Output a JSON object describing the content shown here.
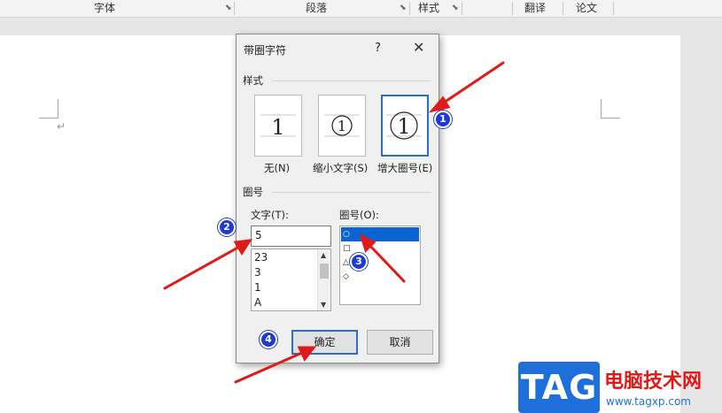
{
  "ribbon": {
    "groups": [
      {
        "label": "字体"
      },
      {
        "label": "段落"
      },
      {
        "label": "样式"
      },
      {
        "label": "翻译"
      },
      {
        "label": "论文"
      }
    ]
  },
  "document": {
    "paragraph_mark": "↵"
  },
  "dialog": {
    "title": "带圈字符",
    "help": "?",
    "close": "✕",
    "style_section": "样式",
    "style_options": [
      {
        "glyph": "1",
        "label": "无(N)",
        "selected": false
      },
      {
        "glyph": "1",
        "label": "缩小文字(S)",
        "selected": false
      },
      {
        "glyph": "1",
        "label": "增大圈号(E)",
        "selected": true
      }
    ],
    "enclosure_section": "圈号",
    "text_label": "文字(T):",
    "text_value": "5",
    "text_list": [
      "23",
      "3",
      "1",
      "A"
    ],
    "enclosure_label": "圈号(O):",
    "enclosure_list": [
      {
        "symbol": "○",
        "selected": true
      },
      {
        "symbol": "□",
        "selected": false
      },
      {
        "symbol": "△",
        "selected": false
      },
      {
        "symbol": "◇",
        "selected": false
      }
    ],
    "ok_label": "确定",
    "cancel_label": "取消"
  },
  "annotations": {
    "badges": [
      "1",
      "2",
      "3",
      "4"
    ],
    "arrow_color": "#e11919",
    "badge_color": "#1f3bd6"
  },
  "watermark": {
    "logo": "TAG",
    "name": "电脑技术网",
    "url": "www.tagxp.com"
  }
}
